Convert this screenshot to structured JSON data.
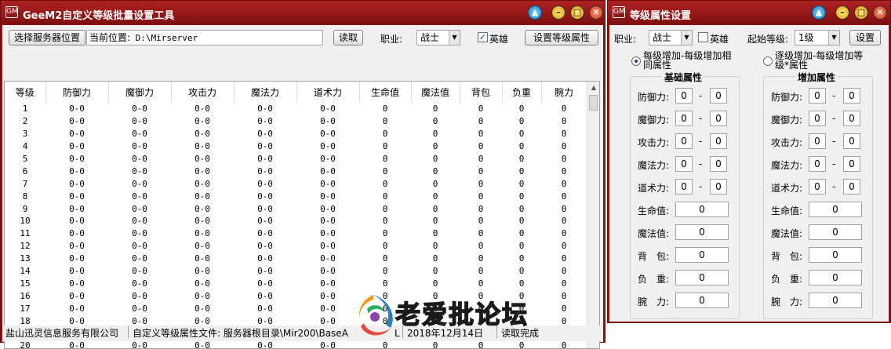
{
  "main": {
    "title": "GeeM2自定义等级批量设置工具",
    "icon_text": "GM",
    "toolbar": {
      "select_server_btn": "选择服务器位置",
      "current_location_label": "当前位置:",
      "location_value": "D:\\Mirserver",
      "read_btn": "读取",
      "job_label": "职业:",
      "job_value": "战士",
      "hero_label": "英雄",
      "set_level_btn": "设置等级属性"
    },
    "table": {
      "headers": [
        "等级",
        "防御力",
        "魔御力",
        "攻击力",
        "魔法力",
        "道术力",
        "生命值",
        "魔法值",
        "背包",
        "负重",
        "腕力"
      ],
      "rows": [
        [
          "1",
          "0-0",
          "0-0",
          "0-0",
          "0-0",
          "0-0",
          "0",
          "0",
          "0",
          "0",
          "0"
        ],
        [
          "2",
          "0-0",
          "0-0",
          "0-0",
          "0-0",
          "0-0",
          "0",
          "0",
          "0",
          "0",
          "0"
        ],
        [
          "3",
          "0-0",
          "0-0",
          "0-0",
          "0-0",
          "0-0",
          "0",
          "0",
          "0",
          "0",
          "0"
        ],
        [
          "4",
          "0-0",
          "0-0",
          "0-0",
          "0-0",
          "0-0",
          "0",
          "0",
          "0",
          "0",
          "0"
        ],
        [
          "5",
          "0-0",
          "0-0",
          "0-0",
          "0-0",
          "0-0",
          "0",
          "0",
          "0",
          "0",
          "0"
        ],
        [
          "6",
          "0-0",
          "0-0",
          "0-0",
          "0-0",
          "0-0",
          "0",
          "0",
          "0",
          "0",
          "0"
        ],
        [
          "7",
          "0-0",
          "0-0",
          "0-0",
          "0-0",
          "0-0",
          "0",
          "0",
          "0",
          "0",
          "0"
        ],
        [
          "8",
          "0-0",
          "0-0",
          "0-0",
          "0-0",
          "0-0",
          "0",
          "0",
          "0",
          "0",
          "0"
        ],
        [
          "9",
          "0-0",
          "0-0",
          "0-0",
          "0-0",
          "0-0",
          "0",
          "0",
          "0",
          "0",
          "0"
        ],
        [
          "10",
          "0-0",
          "0-0",
          "0-0",
          "0-0",
          "0-0",
          "0",
          "0",
          "0",
          "0",
          "0"
        ],
        [
          "11",
          "0-0",
          "0-0",
          "0-0",
          "0-0",
          "0-0",
          "0",
          "0",
          "0",
          "0",
          "0"
        ],
        [
          "12",
          "0-0",
          "0-0",
          "0-0",
          "0-0",
          "0-0",
          "0",
          "0",
          "0",
          "0",
          "0"
        ],
        [
          "13",
          "0-0",
          "0-0",
          "0-0",
          "0-0",
          "0-0",
          "0",
          "0",
          "0",
          "0",
          "0"
        ],
        [
          "14",
          "0-0",
          "0-0",
          "0-0",
          "0-0",
          "0-0",
          "0",
          "0",
          "0",
          "0",
          "0"
        ],
        [
          "15",
          "0-0",
          "0-0",
          "0-0",
          "0-0",
          "0-0",
          "0",
          "0",
          "0",
          "0",
          "0"
        ],
        [
          "16",
          "0-0",
          "0-0",
          "0-0",
          "0-0",
          "0-0",
          "0",
          "0",
          "0",
          "0",
          "0"
        ],
        [
          "17",
          "0-0",
          "0-0",
          "0-0",
          "0-0",
          "0-0",
          "0",
          "0",
          "0",
          "0",
          "0"
        ],
        [
          "18",
          "0-0",
          "0-0",
          "0-0",
          "0-0",
          "0-0",
          "0",
          "0",
          "0",
          "0",
          "0"
        ],
        [
          "19",
          "0-0",
          "0-0",
          "0-0",
          "0-0",
          "0-0",
          "0",
          "0",
          "0",
          "0",
          "0"
        ],
        [
          "20",
          "0-0",
          "0-0",
          "0-0",
          "0-0",
          "0-0",
          "0",
          "0",
          "0",
          "0",
          "0"
        ]
      ]
    },
    "status": {
      "company": "盐山迅灵信息服务有限公司",
      "file_label": "自定义等级属性文件: 服务器根目录\\Mir200\\BaseA",
      "file_tail": "L",
      "date": "2018年12月14日",
      "state": "读取完成"
    }
  },
  "dialog": {
    "title": "等级属性设置",
    "job_label": "职业:",
    "job_value": "战士",
    "hero_label": "英雄",
    "start_level_label": "起始等级:",
    "start_level_value": "1级",
    "set_btn": "设置",
    "radio1": "每级增加-每级增加相同属性",
    "radio2": "逐级增加-每级增加等级*属性",
    "base_group": "基础属性",
    "add_group": "增加属性",
    "dash": "-",
    "base": {
      "def_label": "防御力:",
      "def_min": "0",
      "def_max": "0",
      "mdef_label": "魔御力:",
      "mdef_min": "0",
      "mdef_max": "0",
      "atk_label": "攻击力:",
      "atk_min": "0",
      "atk_max": "0",
      "mag_label": "魔法力:",
      "mag_min": "0",
      "mag_max": "0",
      "tao_label": "道术力:",
      "tao_min": "0",
      "tao_max": "0",
      "hp_label": "生命值:",
      "hp": "0",
      "mp_label": "魔法值:",
      "mp": "0",
      "bag_label": "背　包:",
      "bag": "0",
      "weight_label": "负　重:",
      "weight": "0",
      "wrist_label": "腕　力:",
      "wrist": "0"
    },
    "add": {
      "def_label": "防御力:",
      "def_min": "0",
      "def_max": "0",
      "mdef_label": "魔御力:",
      "mdef_min": "0",
      "mdef_max": "0",
      "atk_label": "攻击力:",
      "atk_min": "0",
      "atk_max": "0",
      "mag_label": "魔法力:",
      "mag_min": "0",
      "mag_max": "0",
      "tao_label": "道术力:",
      "tao_min": "0",
      "tao_max": "0",
      "hp_label": "生命值:",
      "hp": "0",
      "mp_label": "魔法值:",
      "mp": "0",
      "bag_label": "背　包:",
      "bag": "0",
      "weight_label": "负　重:",
      "weight": "0",
      "wrist_label": "腕　力:",
      "wrist": "0"
    }
  },
  "watermark": {
    "text": "老爱批论坛"
  },
  "colors": {
    "titlebar": "#9c1a1a",
    "frame": "#8e1414",
    "client": "#f0f0f0"
  }
}
